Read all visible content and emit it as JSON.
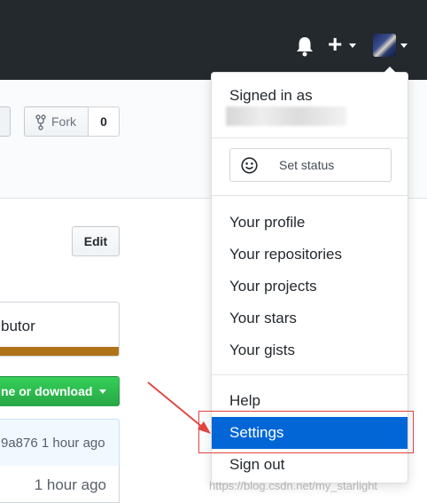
{
  "header": {
    "bell_icon": "bell-icon",
    "plus_label": "+",
    "avatar_icon": "avatar"
  },
  "repo": {
    "fork_label": "Fork",
    "fork_count": "0",
    "edit_label": "Edit",
    "contributor_text": "butor",
    "language_color": "#b07219",
    "clone_label": "ne or download",
    "commit_text": "9a876 1 hour ago",
    "file_age": "1 hour ago"
  },
  "dropdown": {
    "signed_in_label": "Signed in as",
    "set_status_label": "Set status",
    "items": [
      {
        "label": "Your profile"
      },
      {
        "label": "Your repositories"
      },
      {
        "label": "Your projects"
      },
      {
        "label": "Your stars"
      },
      {
        "label": "Your gists"
      }
    ],
    "help_label": "Help",
    "settings_label": "Settings",
    "signout_label": "Sign out"
  },
  "colors": {
    "topbar": "#24292e",
    "active_item": "#0366d6",
    "annotation": "#e0443e",
    "clone_green": "#28a745"
  },
  "watermark": "https://blog.csdn.net/my_starlight"
}
